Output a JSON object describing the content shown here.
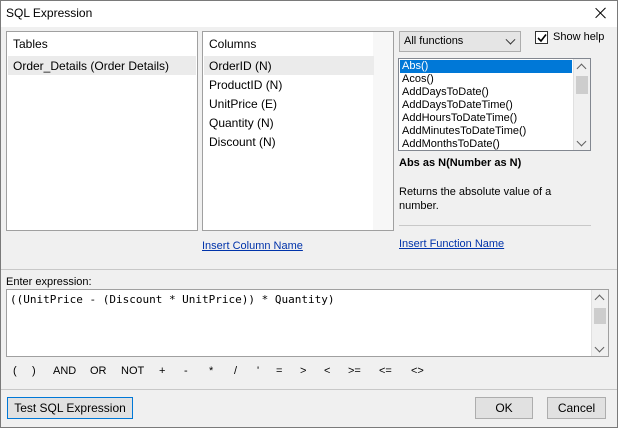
{
  "window": {
    "title": "SQL Expression"
  },
  "tables": {
    "header": "Tables",
    "items": [
      "Order_Details (Order Details)"
    ]
  },
  "columns": {
    "header": "Columns",
    "items": [
      "OrderID (N)",
      "ProductID (N)",
      "UnitPrice (E)",
      "Quantity (N)",
      "Discount (N)"
    ]
  },
  "insert_column_link": "Insert Column Name",
  "functions": {
    "category": "All functions",
    "show_help_label": "Show help",
    "show_help_checked": true,
    "items": [
      "Abs()",
      "Acos()",
      "AddDaysToDate()",
      "AddDaysToDateTime()",
      "AddHoursToDateTime()",
      "AddMinutesToDateTime()",
      "AddMonthsToDate()"
    ],
    "selected": "Abs()",
    "signature": "Abs as N(Number as N)",
    "description": "Returns the absolute value of a number.",
    "insert_link": "Insert Function Name"
  },
  "expression": {
    "label": "Enter expression:",
    "value": "((UnitPrice - (Discount * UnitPrice)) * Quantity)"
  },
  "operators": [
    "(",
    ")",
    "AND",
    "OR",
    "NOT",
    "+",
    "-",
    "*",
    "/",
    "'",
    "=",
    ">",
    "<",
    ">=",
    "<=",
    "<>"
  ],
  "buttons": {
    "test": "Test SQL Expression",
    "ok": "OK",
    "cancel": "Cancel"
  }
}
